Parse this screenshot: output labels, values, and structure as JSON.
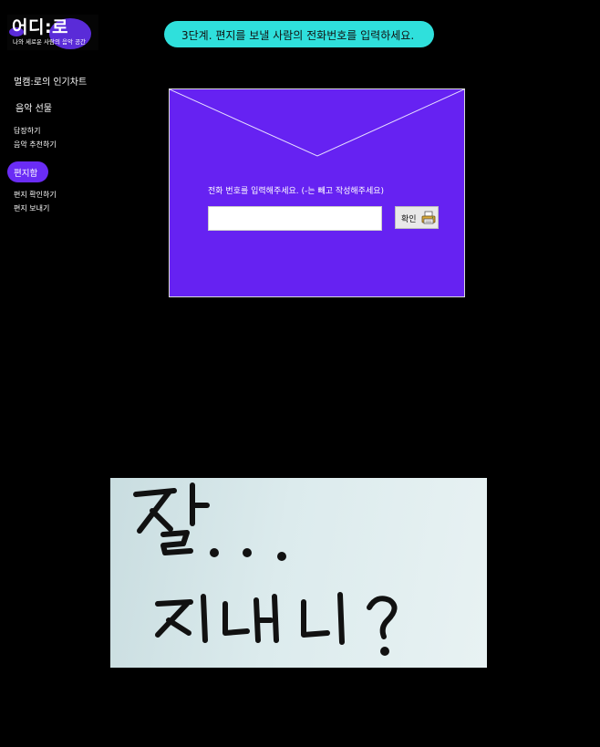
{
  "logo": {
    "title": "어디:로",
    "subtitle": "나와 세로운 사람의 음악 공간"
  },
  "sidebar": {
    "items": [
      {
        "label": "멀캠:로의 인기차트"
      },
      {
        "label": "음악 선물"
      },
      {
        "label": "답장하기"
      },
      {
        "label": "음악 추천하기"
      },
      {
        "label": "편지함"
      },
      {
        "label": "편지 확인하기"
      },
      {
        "label": "편지 보내기"
      }
    ]
  },
  "step": {
    "text": "3단계.  편지를 보낼 사람의 전화번호를 입력하세요."
  },
  "envelope": {
    "prompt": "전화 번호를 입력해주세요. (-는 빼고 작성해주세요)",
    "phone_value": "",
    "confirm_label": "확인",
    "confirm_icon": "printer-icon"
  },
  "handwriting": {
    "text": "잘... 지내니?"
  },
  "colors": {
    "background": "#000000",
    "accent_purple": "#6622f2",
    "banner_cyan": "#2fe0dc"
  }
}
